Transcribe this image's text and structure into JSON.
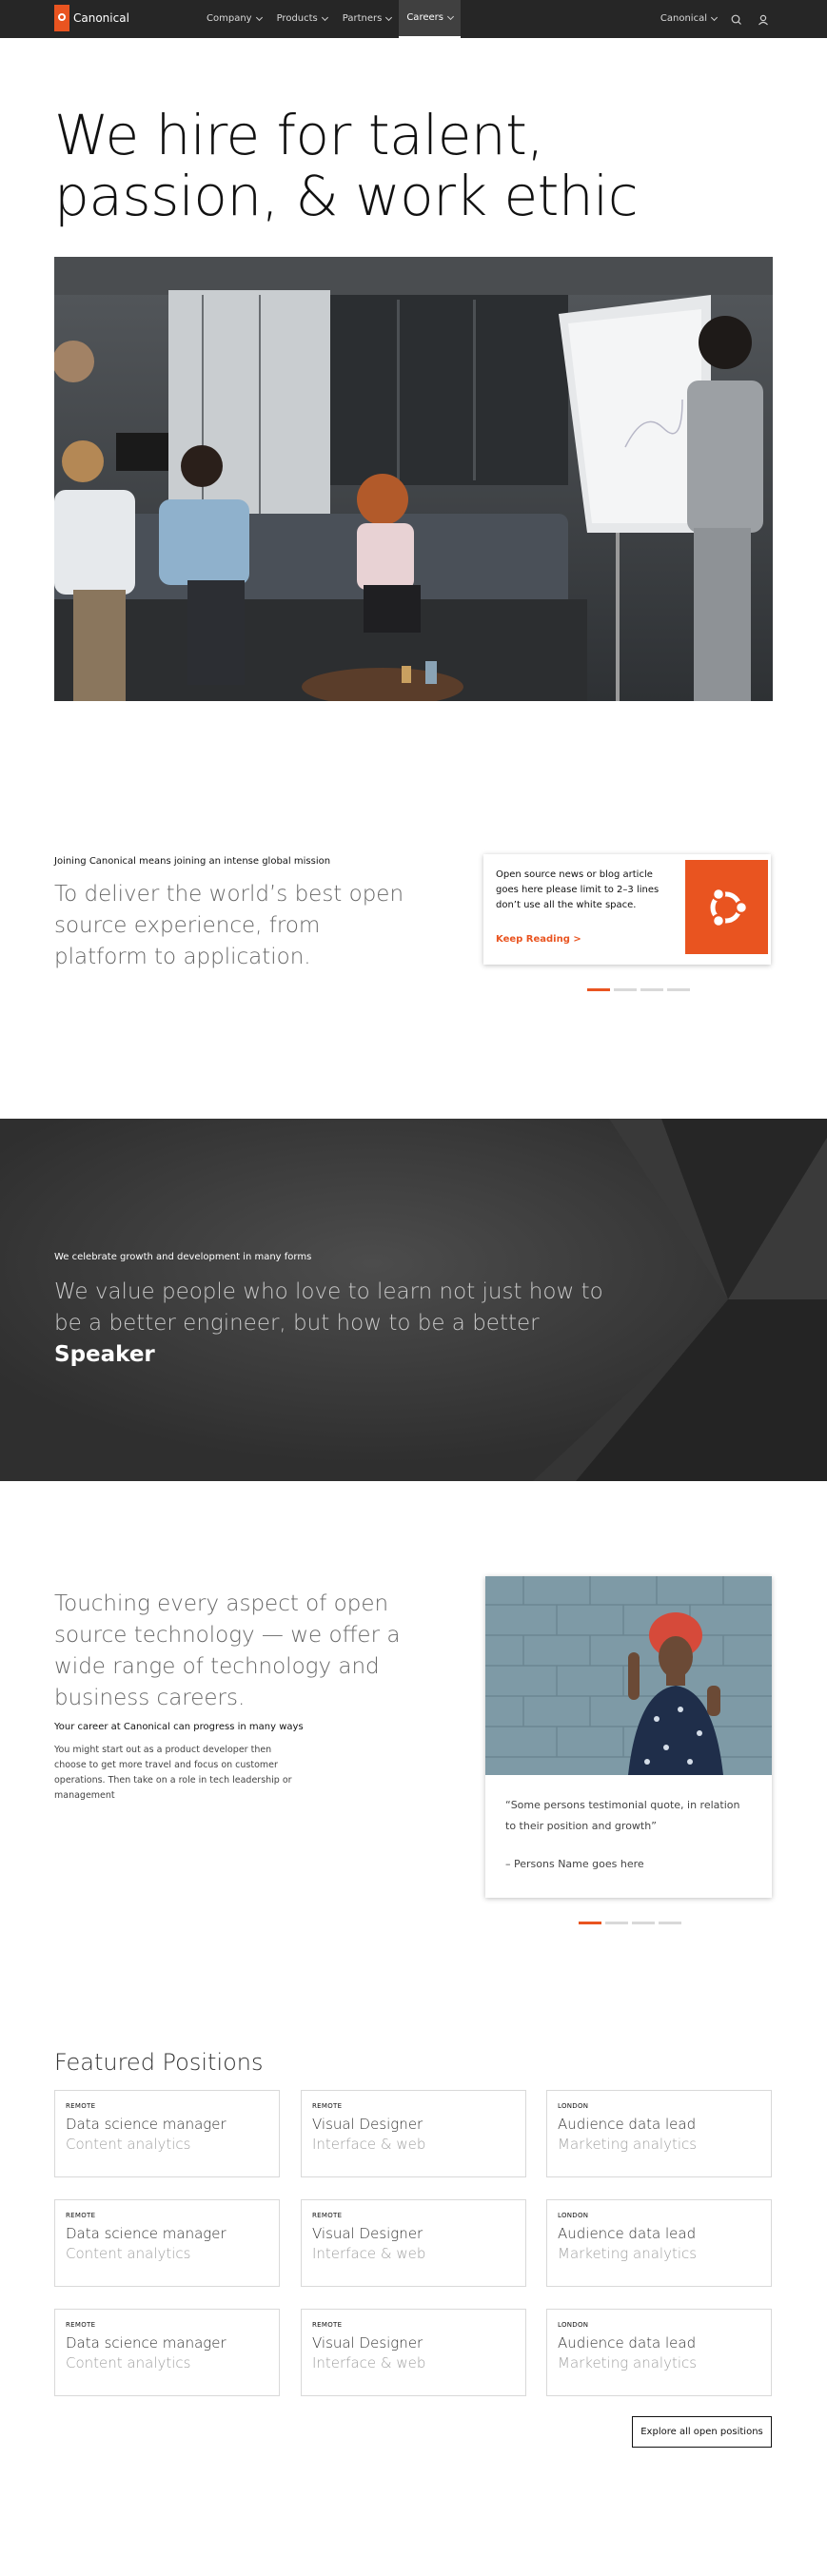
{
  "nav": {
    "brand": "Canonical",
    "items": [
      {
        "label": "Company"
      },
      {
        "label": "Products"
      },
      {
        "label": "Partners"
      },
      {
        "label": "Careers"
      }
    ],
    "right_label": "Canonical",
    "active": "Careers"
  },
  "hero": {
    "title_line1": "We hire for talent,",
    "title_line2": "passion, & work ethic"
  },
  "mission": {
    "eyebrow": "Joining Canonical means joining an intense global mission",
    "text": "To deliver the world’s best open source experience, from platform to application.",
    "news": {
      "text": "Open source news or blog article goes here please limit to 2–3 lines don’t use all the white space.",
      "link": "Keep Reading >"
    },
    "carousel_active": 1
  },
  "band": {
    "eyebrow": "We celebrate growth and development in many forms",
    "text": "We value people who love to learn not just how to be a better engineer, but how to be a better",
    "highlight": "Speaker"
  },
  "careers": {
    "text": "Touching every aspect of open source technology — we offer a wide range of technology and business careers.",
    "subheading": "Your career at Canonical can progress in many ways",
    "body": "You might start out as a product developer then choose to get more travel and focus on customer operations. Then take on a role in tech leadership or management",
    "testimonial": {
      "quote": "“Some persons testimonial quote, in relation to their position and growth”",
      "name": "– Persons Name goes here"
    },
    "carousel_active": 1
  },
  "positions": {
    "title": "Featured Positions",
    "cards": [
      {
        "location": "REMOTE",
        "role": "Data science manager",
        "team": "Content analytics"
      },
      {
        "location": "REMOTE",
        "role": "Visual Designer",
        "team": "Interface & web"
      },
      {
        "location": "LONDON",
        "role": "Audience data lead",
        "team": "Marketing analytics"
      },
      {
        "location": "REMOTE",
        "role": "Data science manager",
        "team": "Content analytics"
      },
      {
        "location": "REMOTE",
        "role": "Visual Designer",
        "team": "Interface & web"
      },
      {
        "location": "LONDON",
        "role": "Audience data lead",
        "team": "Marketing analytics"
      },
      {
        "location": "REMOTE",
        "role": "Data science manager",
        "team": "Content analytics"
      },
      {
        "location": "REMOTE",
        "role": "Visual Designer",
        "team": "Interface & web"
      },
      {
        "location": "LONDON",
        "role": "Audience data lead",
        "team": "Marketing analytics"
      }
    ],
    "explore_label": "Explore all open positions"
  },
  "colors": {
    "accent": "#e95420",
    "nav_bg": "#262626",
    "band_bg": "#2f2f2f"
  },
  "icons": [
    "search-icon",
    "user-icon",
    "chevron-down-icon",
    "ubuntu-logo-icon"
  ]
}
